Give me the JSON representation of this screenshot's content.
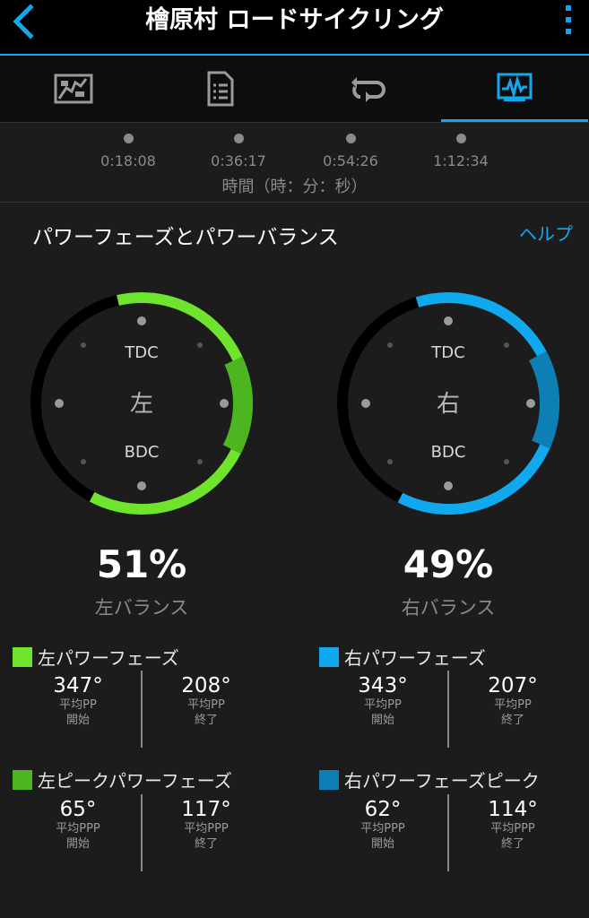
{
  "header": {
    "title": "檜原村 ロードサイクリング"
  },
  "tabs": [
    {
      "name": "map-tab",
      "icon": "map-icon"
    },
    {
      "name": "details-tab",
      "icon": "document-list-icon"
    },
    {
      "name": "laps-tab",
      "icon": "loop-icon"
    },
    {
      "name": "charts-tab",
      "icon": "activity-chart-icon",
      "active": true
    }
  ],
  "timeline": {
    "ticks": [
      "0:18:08",
      "0:36:17",
      "0:54:26",
      "1:12:34"
    ],
    "axis_label": "時間（時：分：秒）"
  },
  "section": {
    "title": "パワーフェーズとパワーバランス",
    "help": "ヘルプ"
  },
  "left": {
    "side": "左",
    "tdc": "TDC",
    "bdc": "BDC",
    "balance": "51%",
    "balance_label": "左バランス",
    "color": "#6ee52c",
    "peak_color": "#4cb520",
    "phase_title": "左パワーフェーズ",
    "phase_start": {
      "value": "347°",
      "line1": "平均PP",
      "line2": "開始"
    },
    "phase_end": {
      "value": "208°",
      "line1": "平均PP",
      "line2": "終了"
    },
    "peak_title": "左ピークパワーフェーズ",
    "peak_start": {
      "value": "65°",
      "line1": "平均PPP",
      "line2": "開始"
    },
    "peak_end": {
      "value": "117°",
      "line1": "平均PPP",
      "line2": "終了"
    }
  },
  "right": {
    "side": "右",
    "tdc": "TDC",
    "bdc": "BDC",
    "balance": "49%",
    "balance_label": "右バランス",
    "color": "#11a9ed",
    "peak_color": "#0e7fb5",
    "phase_title": "右パワーフェーズ",
    "phase_start": {
      "value": "343°",
      "line1": "平均PP",
      "line2": "開始"
    },
    "phase_end": {
      "value": "207°",
      "line1": "平均PP",
      "line2": "終了"
    },
    "peak_title": "右パワーフェーズピーク",
    "peak_start": {
      "value": "62°",
      "line1": "平均PPP",
      "line2": "開始"
    },
    "peak_end": {
      "value": "114°",
      "line1": "平均PPP",
      "line2": "終了"
    }
  }
}
